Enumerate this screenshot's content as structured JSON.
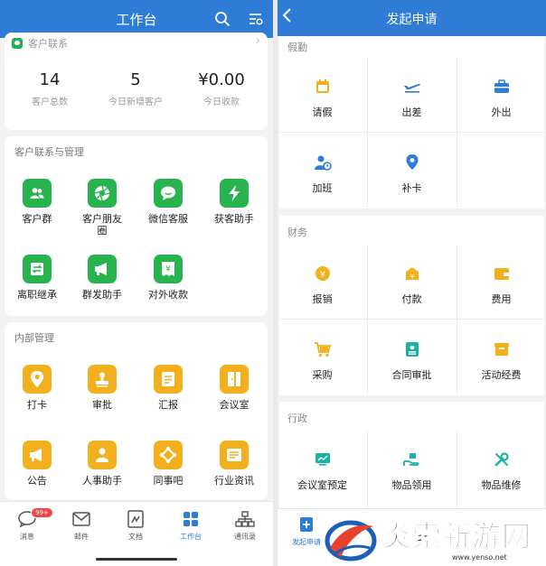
{
  "left": {
    "header": {
      "title": "工作台",
      "search_icon": "search-icon",
      "settings_icon": "list-settings-icon"
    },
    "stats_card": {
      "title": "客户联系",
      "stats": [
        {
          "value": "14",
          "label": "客户总数"
        },
        {
          "value": "5",
          "label": "今日新增客户"
        },
        {
          "value": "¥0.00",
          "label": "今日收款"
        }
      ]
    },
    "customer_section": {
      "title": "客户联系与管理",
      "items": [
        {
          "label": "客户群",
          "icon": "people-icon"
        },
        {
          "label": "客户朋友圈",
          "icon": "aperture-icon"
        },
        {
          "label": "微信客服",
          "icon": "chat-bubble-icon"
        },
        {
          "label": "获客助手",
          "icon": "lightning-icon"
        },
        {
          "label": "离职继承",
          "icon": "transfer-icon"
        },
        {
          "label": "群发助手",
          "icon": "megaphone-icon"
        },
        {
          "label": "对外收款",
          "icon": "yuan-receipt-icon"
        }
      ]
    },
    "internal_section": {
      "title": "内部管理",
      "items": [
        {
          "label": "打卡",
          "icon": "location-pin-icon"
        },
        {
          "label": "审批",
          "icon": "stamp-icon"
        },
        {
          "label": "汇报",
          "icon": "report-icon"
        },
        {
          "label": "会议室",
          "icon": "door-icon"
        },
        {
          "label": "公告",
          "icon": "megaphone-icon"
        },
        {
          "label": "人事助手",
          "icon": "person-icon"
        },
        {
          "label": "同事吧",
          "icon": "network-icon"
        },
        {
          "label": "行业资讯",
          "icon": "news-icon"
        }
      ]
    },
    "tabbar": {
      "badge": "99+",
      "tabs": [
        {
          "label": "消息",
          "icon": "chat-icon"
        },
        {
          "label": "邮件",
          "icon": "mail-icon"
        },
        {
          "label": "文档",
          "icon": "document-icon"
        },
        {
          "label": "工作台",
          "icon": "grid-icon",
          "active": true
        },
        {
          "label": "通讯录",
          "icon": "org-chart-icon"
        }
      ]
    }
  },
  "right": {
    "header": {
      "title": "发起申请",
      "back_icon": "chevron-left-icon"
    },
    "sections": [
      {
        "title": "假勤",
        "items": [
          {
            "label": "请假",
            "icon": "calendar-icon"
          },
          {
            "label": "出差",
            "icon": "airplane-icon"
          },
          {
            "label": "外出",
            "icon": "briefcase-icon"
          },
          {
            "label": "加班",
            "icon": "person-clock-icon"
          },
          {
            "label": "补卡",
            "icon": "location-pin-icon"
          }
        ]
      },
      {
        "title": "财务",
        "items": [
          {
            "label": "报销",
            "icon": "yuan-coin-icon"
          },
          {
            "label": "付款",
            "icon": "payment-icon"
          },
          {
            "label": "费用",
            "icon": "wallet-icon"
          },
          {
            "label": "采购",
            "icon": "cart-icon"
          },
          {
            "label": "合同审批",
            "icon": "contract-icon"
          },
          {
            "label": "活动经费",
            "icon": "gift-box-icon"
          }
        ]
      },
      {
        "title": "行政",
        "items": [
          {
            "label": "会议室预定",
            "icon": "presentation-icon"
          },
          {
            "label": "物品领用",
            "icon": "hand-item-icon"
          },
          {
            "label": "物品维修",
            "icon": "wrench-icon"
          }
        ]
      }
    ],
    "tabbar": {
      "label": "发起申请",
      "icon": "plus-doc-icon"
    }
  },
  "watermark": {
    "text": "炎索新游网",
    "url": "www.yenso.net"
  },
  "colors": {
    "brand_blue": "#2f7cd6",
    "green": "#29b34f",
    "yellow": "#f2b01e",
    "teal": "#19b3a6",
    "badge_red": "#f04545"
  }
}
